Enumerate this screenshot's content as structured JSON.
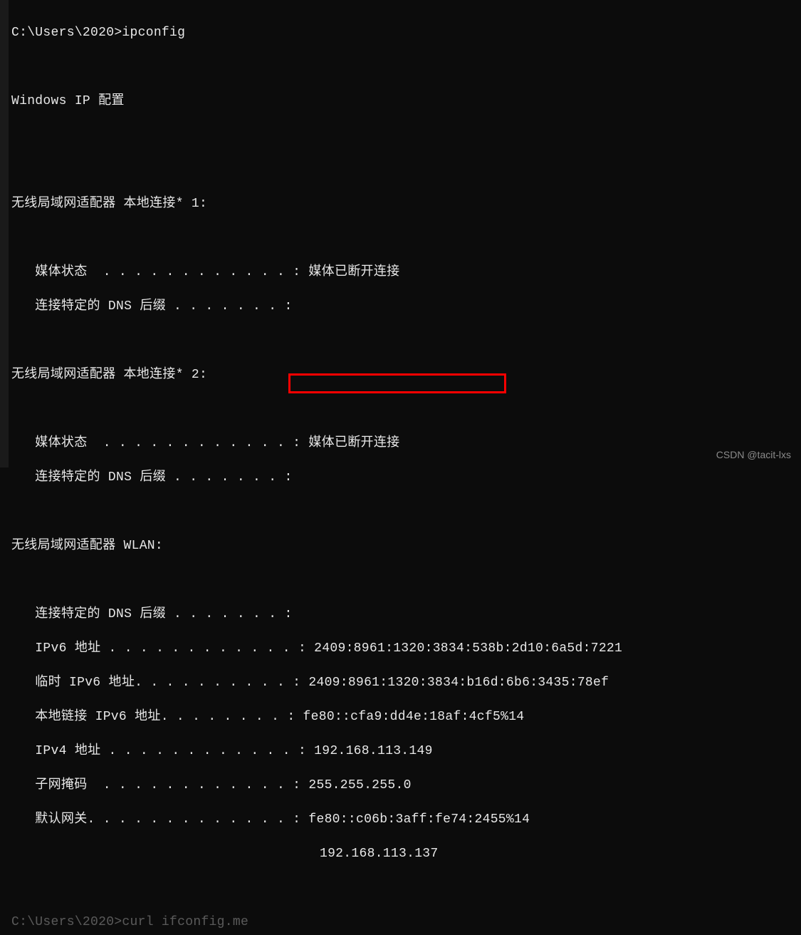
{
  "prompt1": "C:\\Users\\2020>ipconfig",
  "blank": "",
  "header": "Windows IP 配置",
  "adapter1": {
    "title": "无线局域网适配器 本地连接* 1:",
    "media_state_label": "   媒体状态  . . . . . . . . . . . . : ",
    "media_state_value": "媒体已断开连接",
    "dns_suffix_label": "   连接特定的 DNS 后缀 . . . . . . . :"
  },
  "adapter2": {
    "title": "无线局域网适配器 本地连接* 2:",
    "media_state_label": "   媒体状态  . . . . . . . . . . . . : ",
    "media_state_value": "媒体已断开连接",
    "dns_suffix_label": "   连接特定的 DNS 后缀 . . . . . . . :"
  },
  "wlan": {
    "title": "无线局域网适配器 WLAN:",
    "dns_suffix_label": "   连接特定的 DNS 后缀 . . . . . . . :",
    "ipv6_label": "   IPv6 地址 . . . . . . . . . . . . : ",
    "ipv6_value": "2409:8961:1320:3834:538b:2d10:6a5d:7221",
    "temp_ipv6_label": "   临时 IPv6 地址. . . . . . . . . . : ",
    "temp_ipv6_value": "2409:8961:1320:3834:b16d:6b6:3435:78ef",
    "link_local_label": "   本地链接 IPv6 地址. . . . . . . . : ",
    "link_local_value": "fe80::cfa9:dd4e:18af:4cf5%14",
    "ipv4_label": "   IPv4 地址 . . . . . . . . . . . . : ",
    "ipv4_value": "192.168.113.149",
    "subnet_label": "   子网掩码  . . . . . . . . . . . . : ",
    "subnet_value": "255.255.255.0",
    "gateway_label": "   默认网关. . . . . . . . . . . . . : ",
    "gateway_value1": "fe80::c06b:3aff:fe74:2455%14",
    "gateway_cont": "                                       ",
    "gateway_value2": "192.168.113.137"
  },
  "prompt2_partial": "C:\\Users\\2020>curl ifconfig.me",
  "watermark": "CSDN @tacit-lxs"
}
